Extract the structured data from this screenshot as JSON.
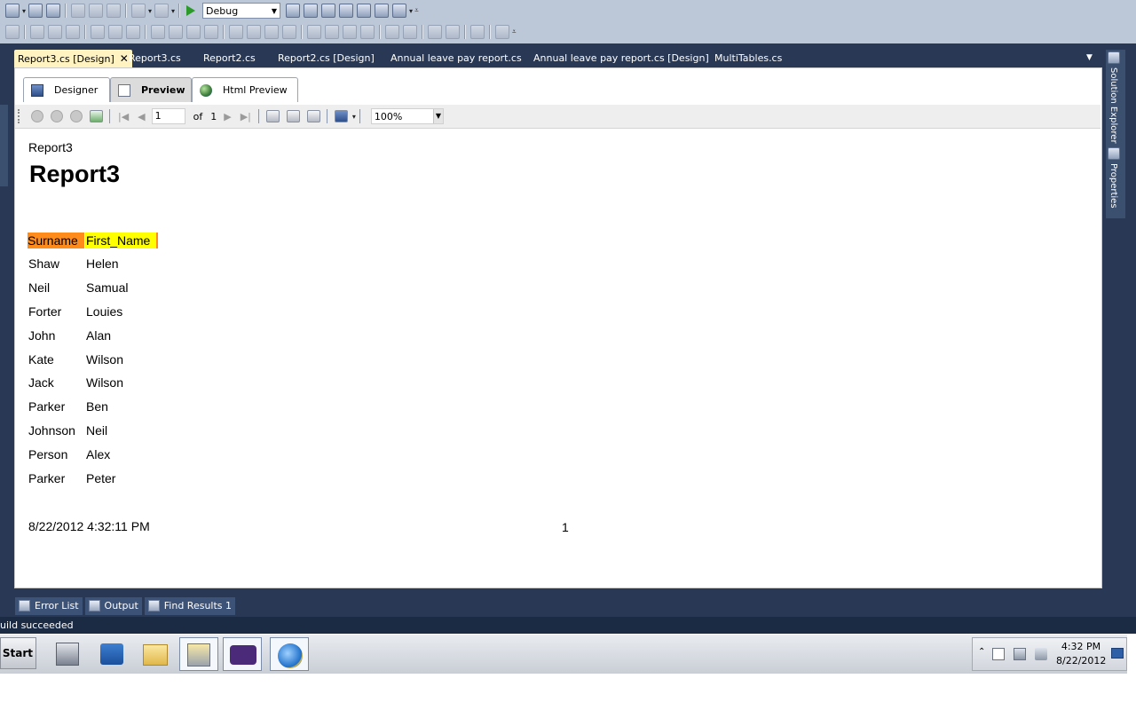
{
  "toolbar": {
    "configuration": "Debug"
  },
  "doc_tabs": [
    {
      "label": "Report3.cs [Design]",
      "active": true
    },
    {
      "label": "Report3.cs"
    },
    {
      "label": "Report2.cs"
    },
    {
      "label": "Report2.cs [Design]"
    },
    {
      "label": "Annual leave pay report.cs"
    },
    {
      "label": "Annual leave pay report.cs [Design]"
    },
    {
      "label": "MultiTables.cs"
    }
  ],
  "close_glyph": "✕",
  "overflow_glyph": "▼",
  "right_sidebar": {
    "solution_explorer": "Solution Explorer",
    "properties": "Properties"
  },
  "view_tabs": {
    "designer": "Designer",
    "preview": "Preview",
    "html_preview": "Html Preview"
  },
  "viewer": {
    "page_value": "1",
    "of_label": "of",
    "total_pages": "1",
    "zoom": "100%"
  },
  "report": {
    "small_title": "Report3",
    "title": "Report3",
    "columns": [
      "Surname",
      "First_Name"
    ],
    "rows": [
      [
        "Shaw",
        "Helen"
      ],
      [
        "Neil",
        "Samual"
      ],
      [
        "Forter",
        "Louies"
      ],
      [
        "John",
        "Alan"
      ],
      [
        "Kate",
        "Wilson"
      ],
      [
        "Jack",
        "Wilson"
      ],
      [
        "Parker",
        "Ben"
      ],
      [
        "Johnson",
        "Neil"
      ],
      [
        "Person",
        "Alex"
      ],
      [
        "Parker",
        "Peter"
      ]
    ],
    "footer_date": "8/22/2012 4:32:11 PM",
    "footer_page": "1"
  },
  "tool_windows": [
    {
      "label": "Error List"
    },
    {
      "label": "Output"
    },
    {
      "label": "Find Results 1"
    }
  ],
  "status": "uild succeeded",
  "taskbar": {
    "start": "Start",
    "time": "4:32 PM",
    "date": "8/22/2012"
  },
  "colors": {
    "ide_background": "#293955",
    "surname_header": "#ff8c1a",
    "firstname_header": "#ffff00",
    "active_doc_tab": "#fff3c2"
  }
}
